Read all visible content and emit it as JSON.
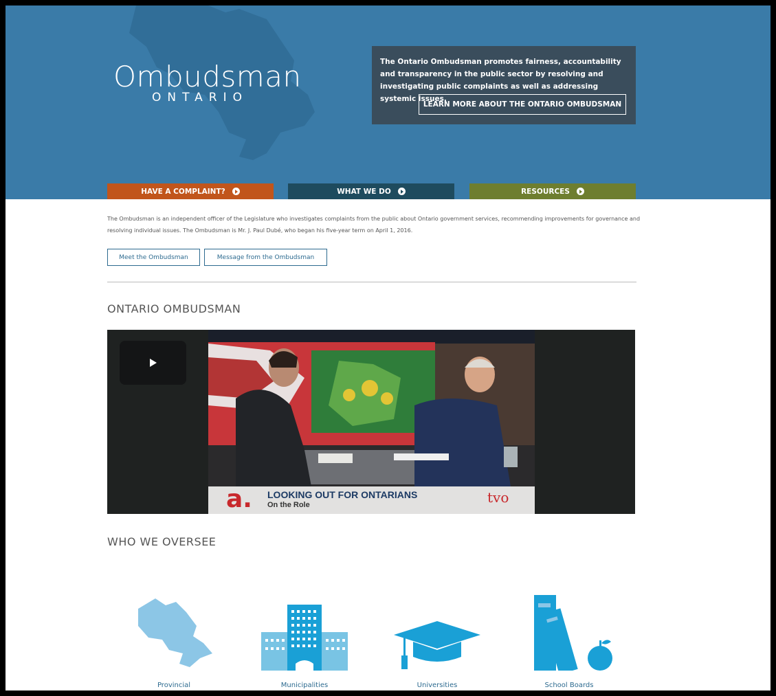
{
  "header": {
    "logo_main": "Ombudsman",
    "logo_sub": "ONTARIO",
    "mission": "The Ontario Ombudsman promotes fairness, accountability and transparency in the public sector by resolving and investigating public complaints as well as addressing systemic issues.",
    "learn_more": "LEARN MORE ABOUT THE ONTARIO OMBUDSMAN",
    "colors": {
      "hero": "#3a7ba8",
      "mission_box": "#3a4d5c"
    }
  },
  "nav": [
    {
      "label": "HAVE A COMPLAINT?",
      "color": "#c1551b",
      "icon": "arrow-circle-icon"
    },
    {
      "label": "WHAT WE DO",
      "color": "#1e4b5e",
      "icon": "arrow-circle-icon"
    },
    {
      "label": "RESOURCES",
      "color": "#6e7e2f",
      "icon": "arrow-circle-icon"
    }
  ],
  "intro": {
    "text": "The Ombudsman is an independent officer of the Legislature who investigates complaints from the public about Ontario government services, recommending improvements for governance and resolving individual issues. The Ombudsman is Mr. J. Paul Dubé, who began his five-year term on April 1, 2016.",
    "buttons": [
      "Meet the Ombudsman",
      "Message from the Ombudsman"
    ]
  },
  "sections": {
    "ontario_title": "ONTARIO OMBUDSMAN",
    "oversee_title": "WHO WE OVERSEE"
  },
  "video": {
    "lower_third_logo": "a.",
    "lower_third_title": "LOOKING OUT FOR ONTARIANS",
    "lower_third_sub": "On the Role",
    "brand": "tvo",
    "play_icon": "play-icon"
  },
  "oversee": [
    {
      "label": "Provincial",
      "icon": "ontario-map-icon"
    },
    {
      "label": "Municipalities",
      "icon": "buildings-icon"
    },
    {
      "label": "Universities",
      "icon": "graduation-cap-icon"
    },
    {
      "label": "School Boards",
      "icon": "books-apple-icon"
    }
  ]
}
